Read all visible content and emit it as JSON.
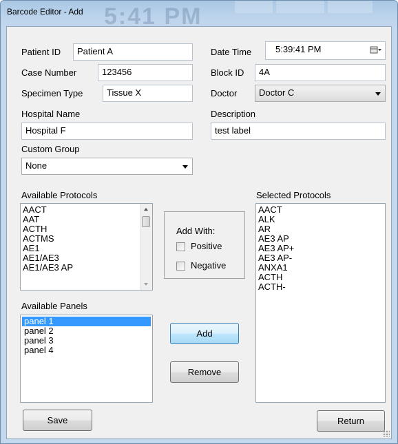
{
  "window": {
    "title": "Barcode Editor - Add",
    "background_time_text": "5:41 PM"
  },
  "form": {
    "patient_id": {
      "label": "Patient ID",
      "value": "Patient A"
    },
    "date_time": {
      "label": "Date Time",
      "value": "5:39:41 PM"
    },
    "case_number": {
      "label": "Case Number",
      "value": "123456"
    },
    "block_id": {
      "label": "Block ID",
      "value": "4A"
    },
    "specimen_type": {
      "label": "Specimen Type",
      "value": "Tissue X"
    },
    "doctor": {
      "label": "Doctor",
      "value": "Doctor C"
    },
    "hospital_name": {
      "label": "Hospital Name",
      "value": "Hospital F"
    },
    "description": {
      "label": "Description",
      "value": "test label"
    },
    "custom_group": {
      "label": "Custom Group",
      "value": "None"
    }
  },
  "available_protocols": {
    "label": "Available Protocols",
    "items": [
      "AACT",
      "AAT",
      "ACTH",
      "ACTMS",
      "AE1",
      "AE1/AE3",
      "AE1/AE3 AP"
    ]
  },
  "available_panels": {
    "label": "Available Panels",
    "items": [
      "panel 1",
      "panel 2",
      "panel 3",
      "panel 4"
    ],
    "selected_index": 0
  },
  "selected_protocols": {
    "label": "Selected Protocols",
    "items": [
      "AACT",
      "ALK",
      "AR",
      "AE3 AP",
      "AE3 AP+",
      "AE3 AP-",
      "ANXA1",
      "ACTH",
      "ACTH-"
    ]
  },
  "add_with": {
    "label": "Add With:",
    "positive_label": "Positive",
    "negative_label": "Negative"
  },
  "buttons": {
    "add": "Add",
    "remove": "Remove",
    "save": "Save",
    "return": "Return"
  },
  "colors": {
    "selection": "#3399ff",
    "accent_border": "#3c7fb1"
  }
}
